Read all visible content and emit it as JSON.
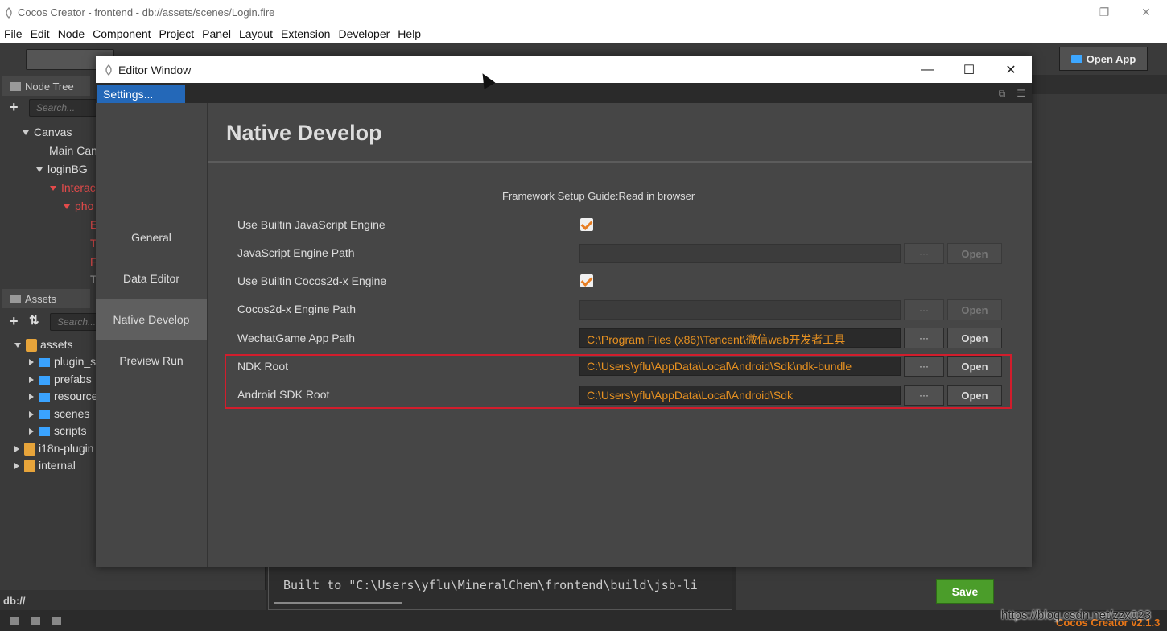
{
  "main_window": {
    "title": "Cocos Creator - frontend - db://assets/scenes/Login.fire",
    "minimize": "—",
    "restore": "❐",
    "close": "✕"
  },
  "menubar": [
    "File",
    "Edit",
    "Node",
    "Component",
    "Project",
    "Panel",
    "Layout",
    "Extension",
    "Developer",
    "Help"
  ],
  "toolbar": {
    "open_app": "Open App"
  },
  "node_tree": {
    "tab_label": "Node Tree",
    "search_placeholder": "Search...",
    "items": [
      {
        "label": "Canvas"
      },
      {
        "label": "Main Can"
      },
      {
        "label": "loginBG"
      },
      {
        "label": "Interac"
      },
      {
        "label": "pho"
      },
      {
        "label": "E"
      },
      {
        "label": "T"
      },
      {
        "label": "F"
      },
      {
        "label": "T"
      }
    ]
  },
  "assets": {
    "tab_label": "Assets",
    "search_placeholder": "Search...",
    "items": [
      {
        "label": "assets"
      },
      {
        "label": "plugin_s"
      },
      {
        "label": "prefabs"
      },
      {
        "label": "resource"
      },
      {
        "label": "scenes"
      },
      {
        "label": "scripts"
      },
      {
        "label": "i18n-plugin"
      },
      {
        "label": "internal"
      }
    ],
    "path": "db://"
  },
  "console": {
    "text": "Built to \"C:\\Users\\yflu\\MineralChem\\frontend\\build\\jsb-li"
  },
  "editor_window": {
    "title": "Editor Window",
    "minimize": "—",
    "maximize": "☐",
    "close": "✕",
    "tab": "Settings...",
    "nav": [
      "General",
      "Data Editor",
      "Native Develop",
      "Preview Run"
    ],
    "active_nav": "Native Develop",
    "heading": "Native Develop",
    "guide": "Framework Setup Guide:Read in browser",
    "rows": {
      "use_builtin_js": {
        "label": "Use Builtin JavaScript Engine",
        "checked": true
      },
      "js_engine_path": {
        "label": "JavaScript Engine Path",
        "value": "",
        "dots": "···",
        "open": "Open"
      },
      "use_builtin_cocos": {
        "label": "Use Builtin Cocos2d-x Engine",
        "checked": true
      },
      "cocos_engine_path": {
        "label": "Cocos2d-x Engine Path",
        "value": "",
        "dots": "···",
        "open": "Open"
      },
      "wechat_path": {
        "label": "WechatGame App Path",
        "value": "C:\\Program Files (x86)\\Tencent\\微信web开发者工具",
        "dots": "···",
        "open": "Open"
      },
      "ndk_root": {
        "label": "NDK Root",
        "value": "C:\\Users\\yflu\\AppData\\Local\\Android\\Sdk\\ndk-bundle",
        "dots": "···",
        "open": "Open"
      },
      "android_sdk_root": {
        "label": "Android SDK Root",
        "value": "C:\\Users\\yflu\\AppData\\Local\\Android\\Sdk",
        "dots": "···",
        "open": "Open"
      }
    },
    "save": "Save"
  },
  "footer": {
    "watermark": "https://blog.csdn.net/zzx023",
    "version": "Cocos Creator v2.1.3"
  },
  "colors": {
    "accent_orange": "#e79121",
    "tab_blue": "#2468b8",
    "highlight_red": "#d21d2c",
    "save_green": "#4b9d2a"
  }
}
